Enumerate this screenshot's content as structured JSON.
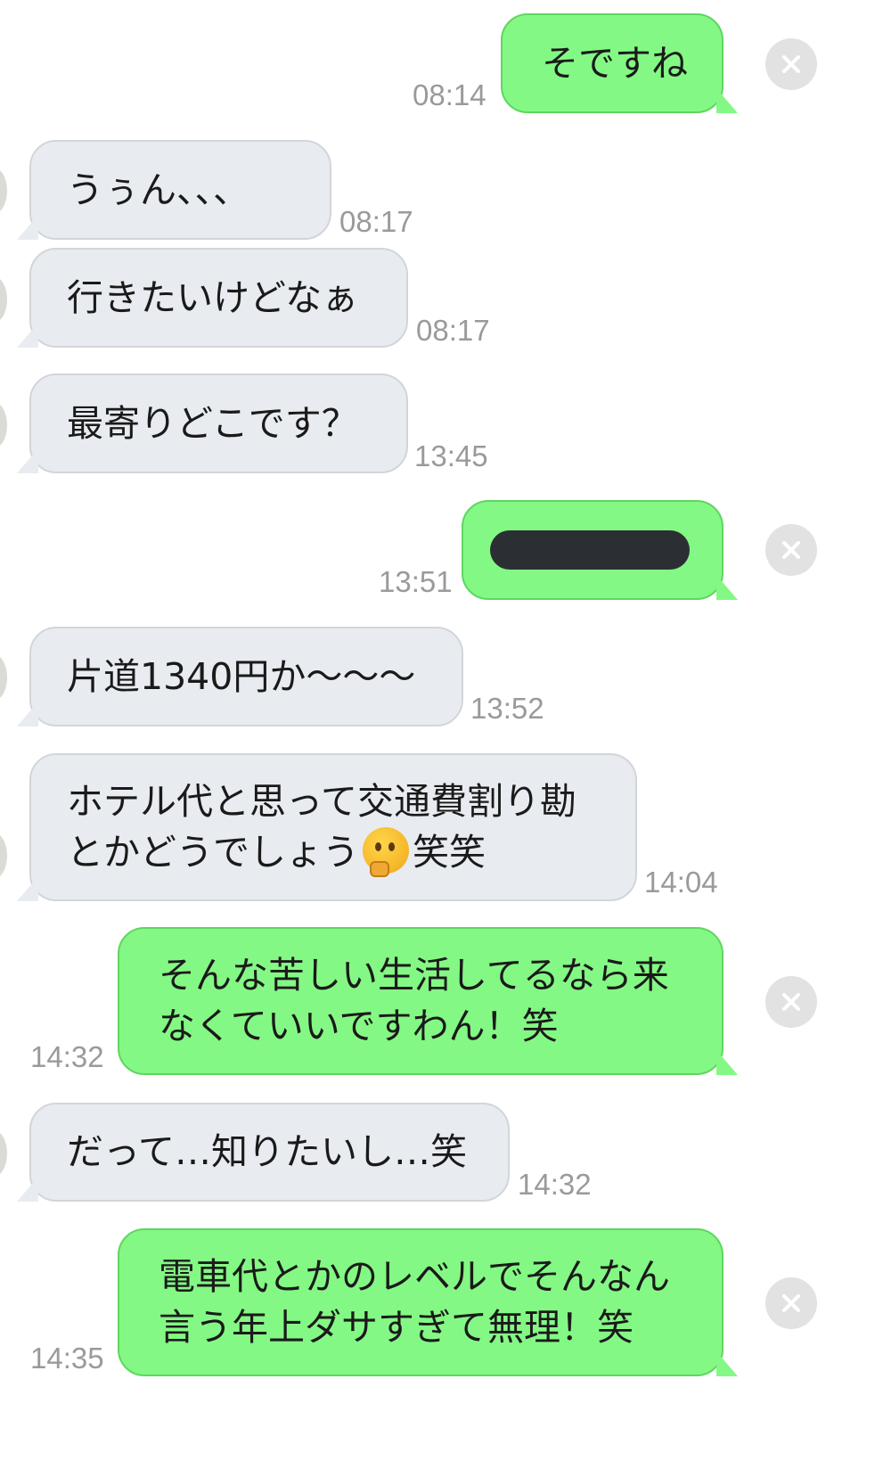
{
  "conversation": {
    "messages": [
      {
        "side": "out",
        "text": "そですね",
        "time": "08:14"
      },
      {
        "side": "in",
        "text": "うぅん、、、",
        "time": "08:17"
      },
      {
        "side": "in",
        "text": "行きたいけどなぁ",
        "time": "08:17"
      },
      {
        "side": "in",
        "text": "最寄りどこです？",
        "time": "13:45"
      },
      {
        "side": "out",
        "text": "",
        "redacted": true,
        "time": "13:51"
      },
      {
        "side": "in",
        "text": "片道1340円か〜〜〜",
        "time": "13:52"
      },
      {
        "side": "in",
        "line1": "ホテル代と思って交通費割り勘",
        "line2a": "とかどうでしょう",
        "emoji": "thinking-face",
        "line2b": "笑笑",
        "time": "14:04"
      },
      {
        "side": "out",
        "line1": "そんな苦しい生活してるなら来",
        "line2": "なくていいですわん！笑",
        "time": "14:32"
      },
      {
        "side": "in",
        "text": "だって…知りたいし…笑",
        "time": "14:32"
      },
      {
        "side": "out",
        "line1": "電車代とかのレベルでそんなん",
        "line2": "言う年上ダサすぎて無理！笑",
        "time": "14:35"
      }
    ]
  },
  "colors": {
    "outgoing_bubble": "#84f884",
    "incoming_bubble": "#e8ebf0",
    "timestamp": "#9a9a9a",
    "dismiss_button": "#e2e2e2"
  }
}
